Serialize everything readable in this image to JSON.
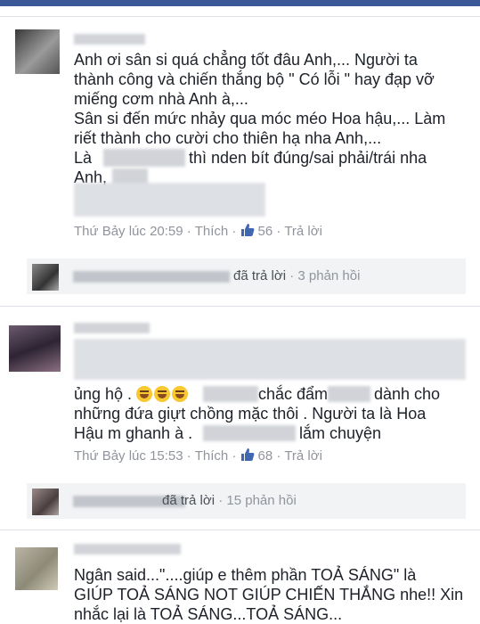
{
  "comments": [
    {
      "lines": [
        "Anh ơi sân si quá chẳng tốt đâu Anh,... Người ta",
        "thành công và chiến thắng bộ \" Có lỗi \" hay đạp vỡ",
        "miếng cơm nhà Anh à,...",
        "Sân si đến mức nhảy qua móc méo Hoa hậu,... Làm",
        "riết thành cho cười cho thiên hạ nha Anh,...",
        "Là",
        "thì nden bít đúng/sai phải/trái nha",
        "Anh,"
      ],
      "timestamp": "Thứ Bảy lúc 20:59",
      "like_label": "Thích",
      "like_count": "56",
      "reply_label": "Trả lời",
      "replies": {
        "action": "đã trả lời",
        "count": "3 phản hồi"
      }
    },
    {
      "lines": [
        "ủng hộ .",
        "chắc đẩm",
        "dành cho",
        "những đứa giựt chồng mặc thôi . Người ta là Hoa",
        "Hậu m ghanh à .",
        "lắm chuyện"
      ],
      "timestamp": "Thứ Bảy lúc 15:53",
      "like_label": "Thích",
      "like_count": "68",
      "reply_label": "Trả lời",
      "replies": {
        "action": "đã trả lời",
        "count": "15 phản hồi"
      }
    },
    {
      "lines": [
        "Ngân said...\"....giúp e thêm phần TOẢ SÁNG\" là",
        "GIÚP TOẢ SÁNG NOT GIÚP CHIẾN THẮNG nhe!! Xin",
        "nhắc lại là TOẢ SÁNG...TOẢ SÁNG..."
      ]
    }
  ],
  "separator": "·",
  "colors": {
    "link": "#90949c",
    "like": "#4267b2",
    "text": "#1d2129",
    "bar": "#3b5998"
  },
  "icons": {
    "like": "thumbs-up-icon",
    "emoji": "laughing-emoji-icon"
  }
}
